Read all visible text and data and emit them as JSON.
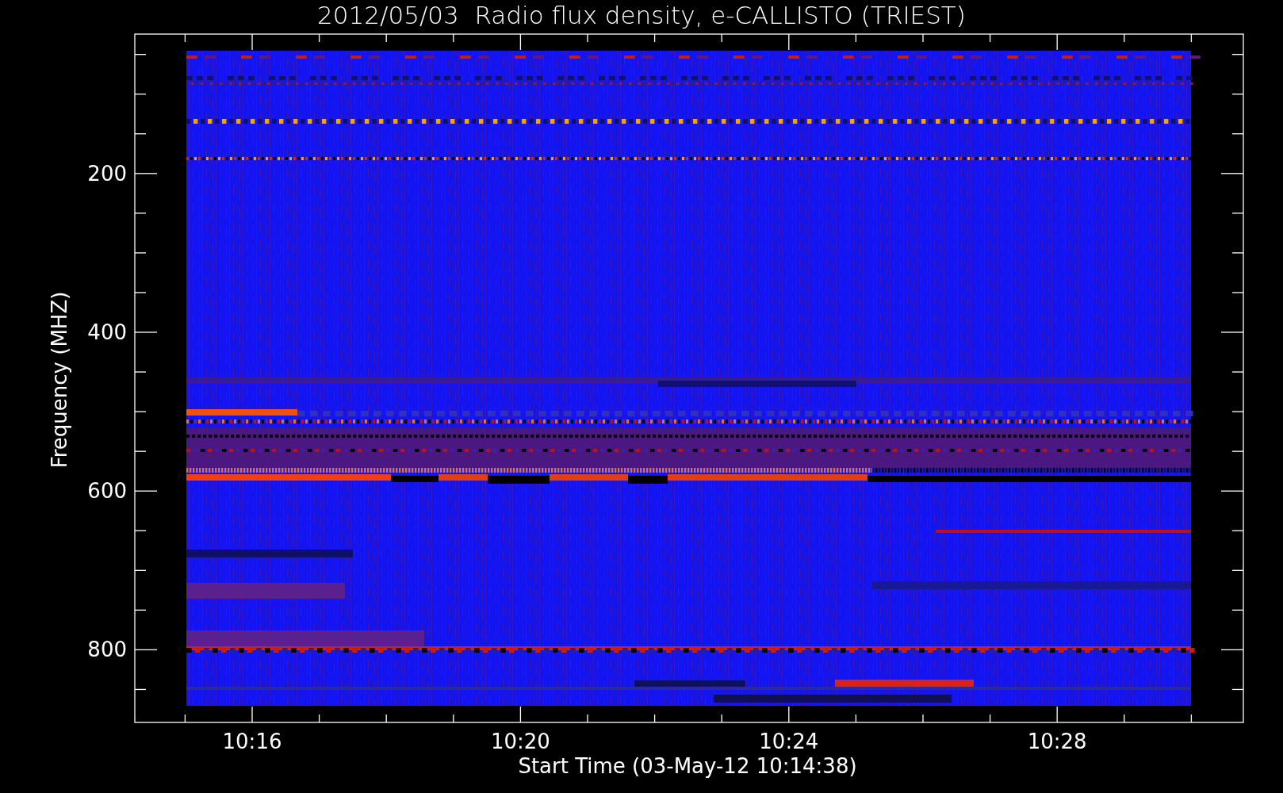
{
  "plot": {
    "title": "2012/05/03  Radio flux density, e-CALLISTO (TRIEST)",
    "xlabel": "Start Time (03-May-12 10:14:38)",
    "ylabel": "Frequency (MHZ)",
    "xticks": [
      "10:16",
      "10:20",
      "10:24",
      "10:28"
    ],
    "yticks": [
      "200",
      "400",
      "600",
      "800"
    ]
  }
}
